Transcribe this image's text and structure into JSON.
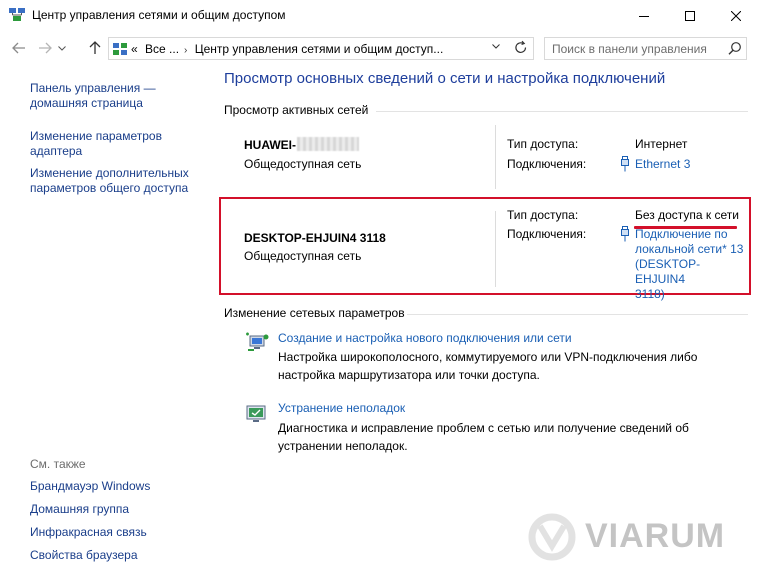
{
  "window": {
    "title": "Центр управления сетями и общим доступом"
  },
  "address": {
    "overflow": "«",
    "crumbs": [
      "Все ...",
      "Центр управления сетями и общим доступ..."
    ]
  },
  "search": {
    "placeholder": "Поиск в панели управления"
  },
  "sidebar": {
    "links": [
      {
        "line1": "Панель управления —",
        "line2": "домашняя страница"
      },
      {
        "line1": "Изменение параметров",
        "line2": "адаптера"
      },
      {
        "line1": "Изменение дополнительных",
        "line2": "параметров общего доступа"
      }
    ],
    "see_also_heading": "См. также",
    "see_also": [
      "Брандмауэр Windows",
      "Домашняя группа",
      "Инфракрасная связь",
      "Свойства браузера"
    ]
  },
  "main": {
    "title": "Просмотр основных сведений о сети и настройка подключений",
    "active_networks_heading": "Просмотр активных сетей",
    "networks": [
      {
        "name": "HUAWEI-",
        "type": "Общедоступная сеть",
        "access_label": "Тип доступа:",
        "access_value": "Интернет",
        "connections_label": "Подключения:",
        "connection": "Ethernet 3"
      },
      {
        "name": "DESKTOP-EHJUIN4 3118",
        "type": "Общедоступная сеть",
        "access_label": "Тип доступа:",
        "access_value": "Без доступа к сети",
        "connections_label": "Подключения:",
        "connection_lines": [
          "Подключение по",
          "локальной сети* 13",
          "(DESKTOP-EHJUIN4",
          "3118)"
        ]
      }
    ],
    "change_settings_heading": "Изменение сетевых параметров",
    "tasks": [
      {
        "icon": "new-connection-icon",
        "link": "Создание и настройка нового подключения или сети",
        "desc1": "Настройка широкополосного, коммутируемого или VPN-подключения либо",
        "desc2": "настройка маршрутизатора или точки доступа."
      },
      {
        "icon": "troubleshoot-icon",
        "link": "Устранение неполадок",
        "desc1": "Диагностика и исправление проблем с сетью или получение сведений об",
        "desc2": "устранении неполадок."
      }
    ]
  },
  "watermark": {
    "text": "VIARUM"
  },
  "colors": {
    "link": "#1a5fb4",
    "title_blue": "#1e3e9c",
    "highlight_red": "#d3102a"
  }
}
